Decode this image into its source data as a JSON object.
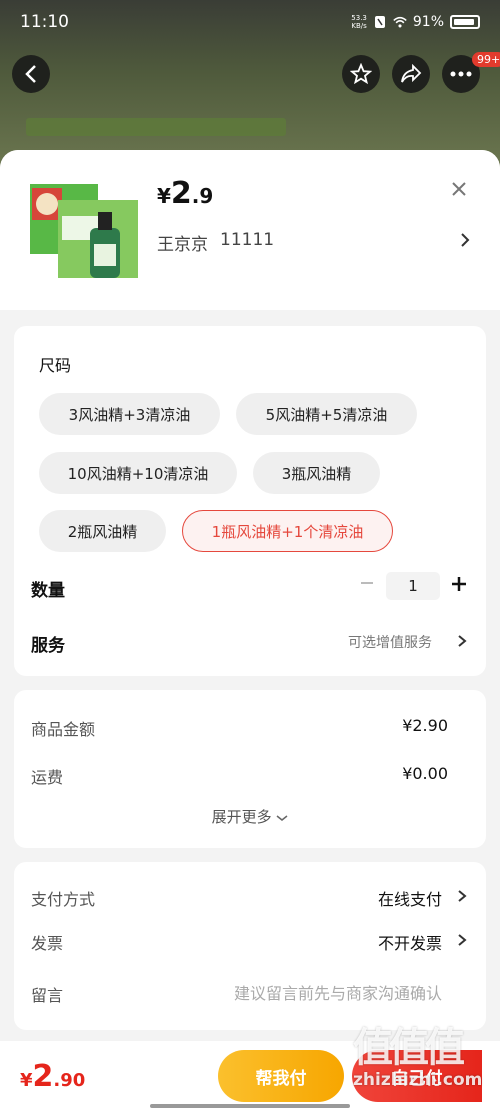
{
  "status_bar": {
    "time": "11:10",
    "net_speed": "53.3",
    "net_unit": "KB/s",
    "battery": "91%"
  },
  "top_bar": {
    "badge": "99+"
  },
  "product": {
    "price_currency": "¥",
    "price_int": "2",
    "price_dec": ".9",
    "address_name": "王京京",
    "address_num": "11111"
  },
  "size": {
    "title": "尺码",
    "options": [
      "3风油精+3清凉油",
      "5风油精+5清凉油",
      "10风油精+10清凉油",
      "3瓶风油精",
      "2瓶风油精",
      "1瓶风油精+1个清凉油"
    ],
    "selected_index": 5
  },
  "quantity": {
    "label": "数量",
    "value": "1"
  },
  "service": {
    "label": "服务",
    "hint": "可选增值服务"
  },
  "summary": {
    "goods_label": "商品金额",
    "goods_value": "¥2.90",
    "freight_label": "运费",
    "freight_value": "¥0.00",
    "expand": "展开更多"
  },
  "options": {
    "payment_label": "支付方式",
    "payment_value": "在线支付",
    "invoice_label": "发票",
    "invoice_value": "不开发票",
    "note_label": "留言",
    "note_placeholder": "建议留言前先与商家沟通确认"
  },
  "bottom": {
    "price_currency": "¥",
    "price_int": "2",
    "price_dec": ".90",
    "help_pay": "帮我付",
    "self_pay": "自己付"
  },
  "watermark": {
    "big": "值值值",
    "small": "zhizhizhi.com"
  },
  "colors": {
    "accent": "#e5251b",
    "help": "#f7a600"
  }
}
